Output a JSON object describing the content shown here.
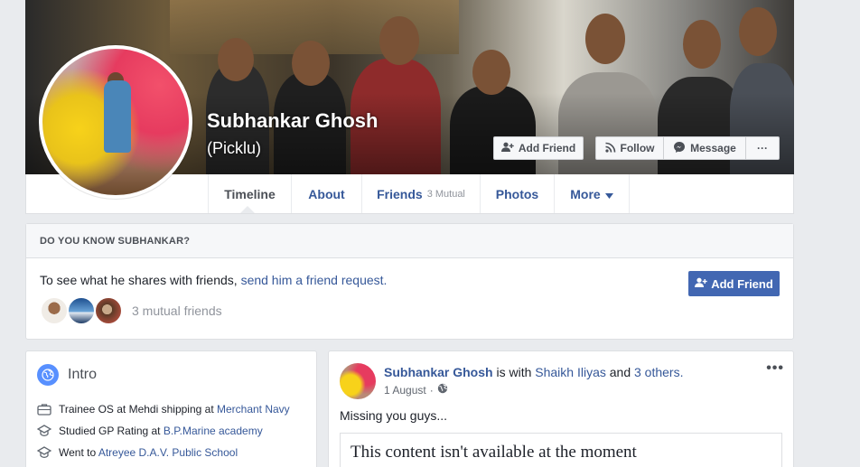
{
  "profile": {
    "name": "Subhankar Ghosh",
    "alt_name": "(Picklu)"
  },
  "cover_actions": {
    "add_friend": "Add Friend",
    "follow": "Follow",
    "message": "Message",
    "more": "···"
  },
  "nav": {
    "tabs": [
      {
        "label": "Timeline"
      },
      {
        "label": "About"
      },
      {
        "label": "Friends",
        "sub": "3 Mutual"
      },
      {
        "label": "Photos"
      },
      {
        "label": "More"
      }
    ]
  },
  "know_card": {
    "heading": "DO YOU KNOW SUBHANKAR?",
    "text_prefix": "To see what he shares with friends, ",
    "link_text": "send him a friend request.",
    "button_label": "Add Friend",
    "mutual_text": "3 mutual friends"
  },
  "intro": {
    "title": "Intro",
    "items": [
      {
        "prefix": "Trainee OS at Mehdi shipping at ",
        "link": "Merchant Navy",
        "icon": "briefcase-icon"
      },
      {
        "prefix": "Studied GP Rating at ",
        "link": "B.P.Marine academy",
        "icon": "graduation-cap-icon"
      },
      {
        "prefix": "Went to ",
        "link": "Atreyee D.A.V. Public School",
        "icon": "graduation-cap-icon"
      }
    ]
  },
  "post": {
    "author": "Subhankar Ghosh",
    "with_text": " is with ",
    "with_name": "Shaikh Iliyas",
    "and_text": " and ",
    "others": "3 others.",
    "date": "1 August",
    "dots": "•••",
    "text": "Missing you guys...",
    "unavailable": "This content isn't available at the moment"
  },
  "colors": {
    "link": "#365899",
    "primary_button": "#4267b2",
    "page_bg": "#e9ebee"
  }
}
